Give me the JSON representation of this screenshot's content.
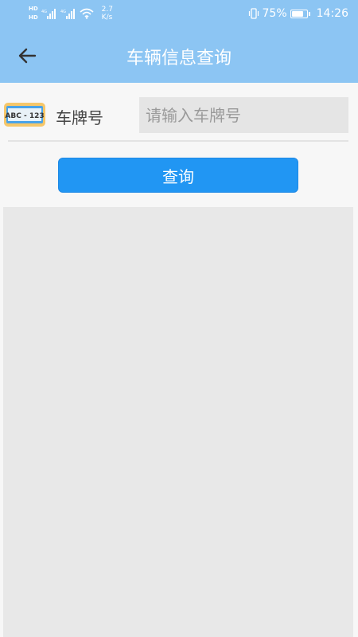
{
  "status_bar": {
    "hd_label_1": "HD",
    "hd_label_2": "HD",
    "net_speed_value": "2.7",
    "net_speed_unit": "K/s",
    "battery": "75%",
    "time": "14:26"
  },
  "header": {
    "title": "车辆信息查询",
    "back_icon": "back-arrow-icon"
  },
  "form": {
    "plate_icon_text": "ABC - 123",
    "plate_label": "车牌号",
    "plate_placeholder": "请输入车牌号",
    "plate_value": ""
  },
  "actions": {
    "query_label": "查询"
  },
  "colors": {
    "header_bg": "#8cc5f3",
    "button_bg": "#2196f3",
    "results_bg": "#e8e8e8"
  }
}
